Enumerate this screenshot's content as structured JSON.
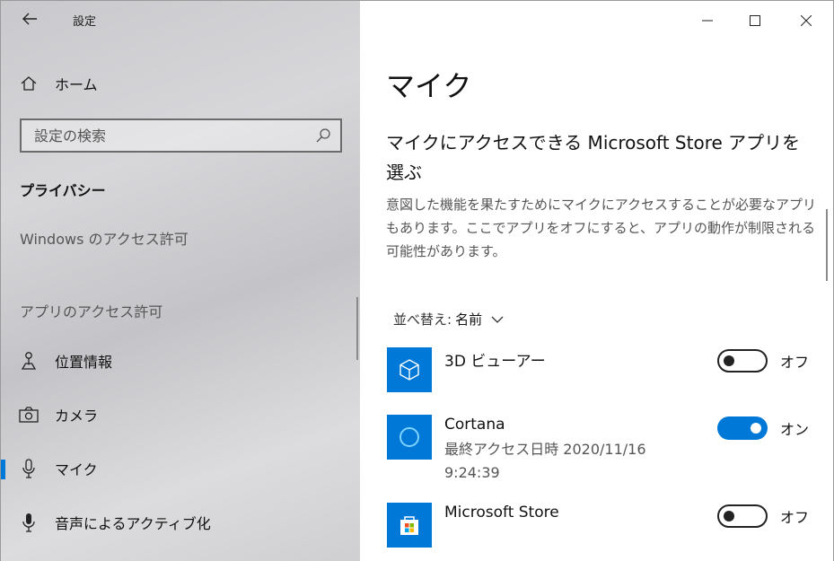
{
  "window": {
    "title": "設定",
    "back_icon": "back-arrow-icon"
  },
  "sidebar": {
    "home_label": "ホーム",
    "search_placeholder": "設定の検索",
    "section_title": "プライバシー",
    "windows_access_label": "Windows のアクセス許可",
    "app_access_label": "アプリのアクセス許可",
    "items": [
      {
        "label": "位置情報",
        "icon": "location-icon"
      },
      {
        "label": "カメラ",
        "icon": "camera-icon"
      },
      {
        "label": "マイク",
        "icon": "microphone-icon",
        "active": true
      },
      {
        "label": "音声によるアクティブ化",
        "icon": "voice-activation-icon"
      }
    ]
  },
  "main": {
    "title": "マイク",
    "subtitle": "マイクにアクセスできる Microsoft Store アプリを選ぶ",
    "description": "意図した機能を果たすためにマイクにアクセスすることが必要なアプリもあります。ここでアプリをオフにすると、アプリの動作が制限される可能性があります。",
    "sort_label": "並べ替え:",
    "sort_value": "名前",
    "apps": [
      {
        "name": "3D ビューアー",
        "meta": "",
        "state": "オフ",
        "on": false
      },
      {
        "name": "Cortana",
        "meta": "最終アクセス日時 2020/11/16 9:24:39",
        "state": "オン",
        "on": true
      },
      {
        "name": "Microsoft Store",
        "meta": "",
        "state": "オフ",
        "on": false
      }
    ]
  },
  "colors": {
    "accent": "#0078d7"
  }
}
